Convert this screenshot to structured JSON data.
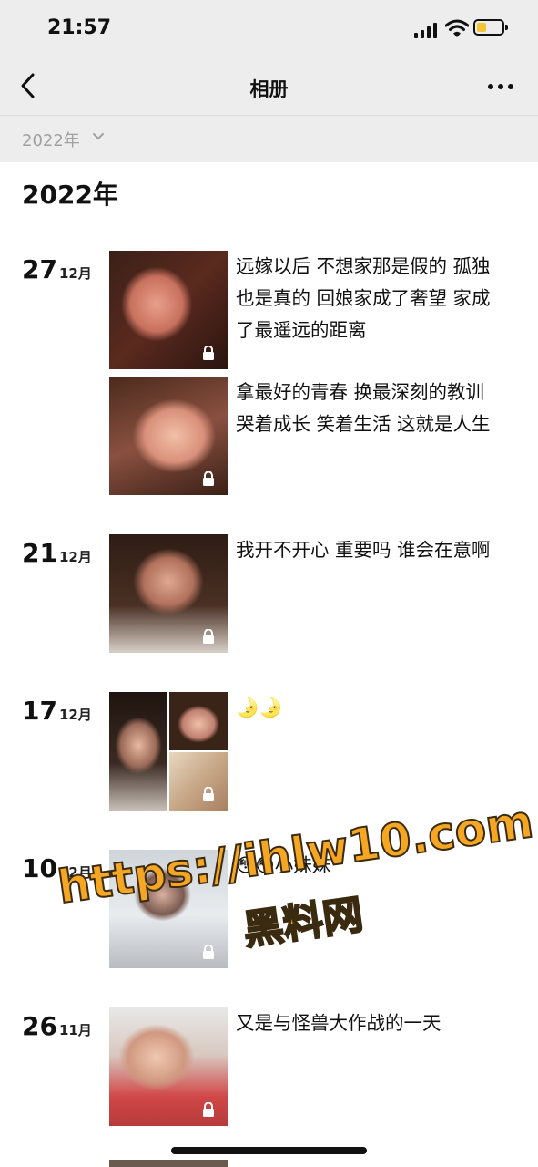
{
  "status_bar": {
    "time": "21:57",
    "battery_color": "#f4c534"
  },
  "navbar": {
    "title": "相册",
    "back_icon": "chevron-left",
    "more_icon": "ellipsis"
  },
  "filter": {
    "label": "2022年",
    "icon": "chevron-down"
  },
  "year_heading": "2022年",
  "entries": [
    {
      "day": "27",
      "month": "12月",
      "posts": [
        {
          "caption": "远嫁以后 不想家那是假的 孤独也是真的 回娘家成了奢望  家成了最遥远的距离",
          "locked": true
        },
        {
          "caption": "拿最好的青春 换最深刻的教训 哭着成长 笑着生活 这就是人生",
          "locked": true
        }
      ]
    },
    {
      "day": "21",
      "month": "12月",
      "posts": [
        {
          "caption": "我开不开心 重要吗 谁会在意啊",
          "locked": true
        }
      ]
    },
    {
      "day": "17",
      "month": "12月",
      "posts": [
        {
          "caption": "🌛🌛",
          "locked": true,
          "grid": true
        }
      ]
    },
    {
      "day": "10",
      "month": "12月",
      "posts": [
        {
          "caption": "😳😳小妹妹",
          "locked": true
        }
      ]
    },
    {
      "day": "26",
      "month": "11月",
      "posts": [
        {
          "caption": "又是与怪兽大作战的一天",
          "locked": true
        }
      ]
    }
  ],
  "watermark": {
    "url": "https://ihlw10.com",
    "name": "黑料网"
  }
}
